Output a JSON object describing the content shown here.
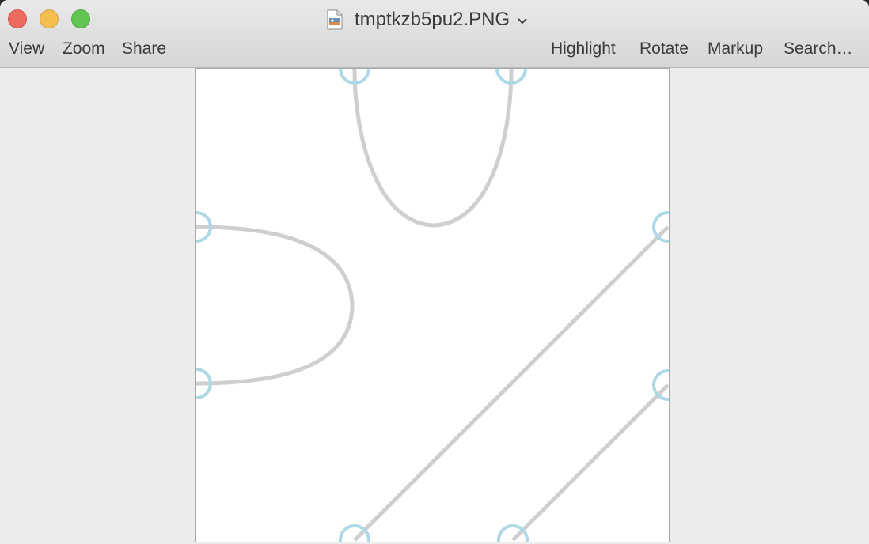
{
  "window": {
    "title": "tmptkzb5pu2.PNG",
    "icons": {
      "close": "close-button",
      "minimize": "minimize-button",
      "zoom": "zoom-button",
      "file": "png-file-icon",
      "dropdown": "chevron-down-icon"
    }
  },
  "toolbar": {
    "left": [
      "View",
      "Zoom",
      "Share"
    ],
    "right": [
      "Highlight",
      "Rotate",
      "Markup",
      "Search…"
    ]
  },
  "colors": {
    "curve": "#cfcfcf",
    "port_circle": "#add8e6",
    "close": "#ed6a5e",
    "minimize": "#f5bf4f",
    "zoom": "#61c554"
  }
}
